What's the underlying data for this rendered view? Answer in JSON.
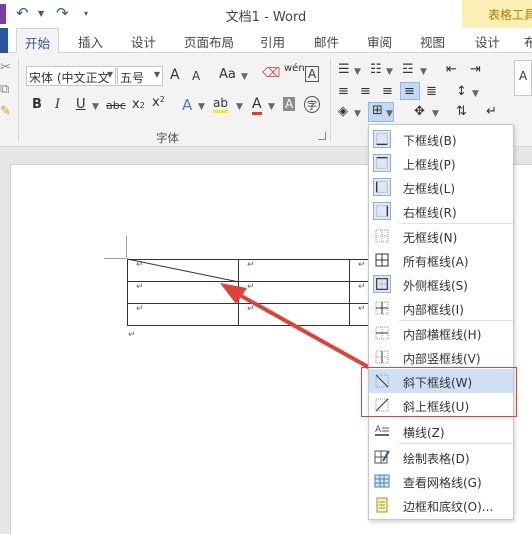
{
  "window": {
    "title": "文档1 - Word",
    "context_tab_title": "表格工具"
  },
  "tabs": [
    {
      "label": "开始",
      "active": true
    },
    {
      "label": "插入"
    },
    {
      "label": "设计"
    },
    {
      "label": "页面布局"
    },
    {
      "label": "引用"
    },
    {
      "label": "邮件"
    },
    {
      "label": "审阅"
    },
    {
      "label": "视图"
    },
    {
      "label": "设计"
    },
    {
      "label": "布"
    }
  ],
  "font_group": {
    "font_name": "宋体 (中文正文",
    "font_size": "五号",
    "grow_label": "A",
    "shrink_label": "A",
    "case_label": "Aa",
    "phonetic_label": "wén",
    "border_char_label": "A",
    "bold": "B",
    "italic": "I",
    "underline": "U",
    "strike": "abc",
    "subscript": "x",
    "superscript": "x",
    "sub_mark": "2",
    "sup_mark": "2",
    "effects": "A",
    "highlight": "ab",
    "font_color": "A",
    "shading_char": "A",
    "circle_char": "字",
    "label": "字体"
  },
  "styles_preview": "A",
  "border_menu": {
    "items": [
      {
        "label": "下框线(B)",
        "icon": "bottom-border-icon"
      },
      {
        "label": "上框线(P)",
        "icon": "top-border-icon"
      },
      {
        "label": "左框线(L)",
        "icon": "left-border-icon"
      },
      {
        "label": "右框线(R)",
        "icon": "right-border-icon"
      },
      {
        "label": "无框线(N)",
        "icon": "no-border-icon"
      },
      {
        "label": "所有框线(A)",
        "icon": "all-borders-icon"
      },
      {
        "label": "外侧框线(S)",
        "icon": "outside-borders-icon"
      },
      {
        "label": "内部框线(I)",
        "icon": "inside-borders-icon"
      },
      {
        "label": "内部横框线(H)",
        "icon": "inside-horizontal-border-icon"
      },
      {
        "label": "内部竖框线(V)",
        "icon": "inside-vertical-border-icon"
      },
      {
        "label": "斜下框线(W)",
        "icon": "diagonal-down-border-icon"
      },
      {
        "label": "斜上框线(U)",
        "icon": "diagonal-up-border-icon"
      },
      {
        "label": "横线(Z)",
        "icon": "horizontal-line-icon"
      },
      {
        "label": "绘制表格(D)",
        "icon": "draw-table-icon"
      },
      {
        "label": "查看网格线(G)",
        "icon": "view-gridlines-icon"
      },
      {
        "label": "边框和底纹(O)...",
        "icon": "borders-shading-icon"
      }
    ]
  },
  "table": {
    "cell_mark": "↵",
    "rows": [
      [
        "↵",
        "↵",
        "↵"
      ],
      [
        "↵",
        "↵",
        "↵"
      ],
      [
        "↵",
        "↵",
        "↵"
      ]
    ],
    "after_mark": "↵"
  },
  "colors": {
    "accent": "#2b579a",
    "annotation_red": "#e0413a",
    "highlight_yellow": "#f7e52a",
    "font_color_red": "#e23b2c"
  }
}
